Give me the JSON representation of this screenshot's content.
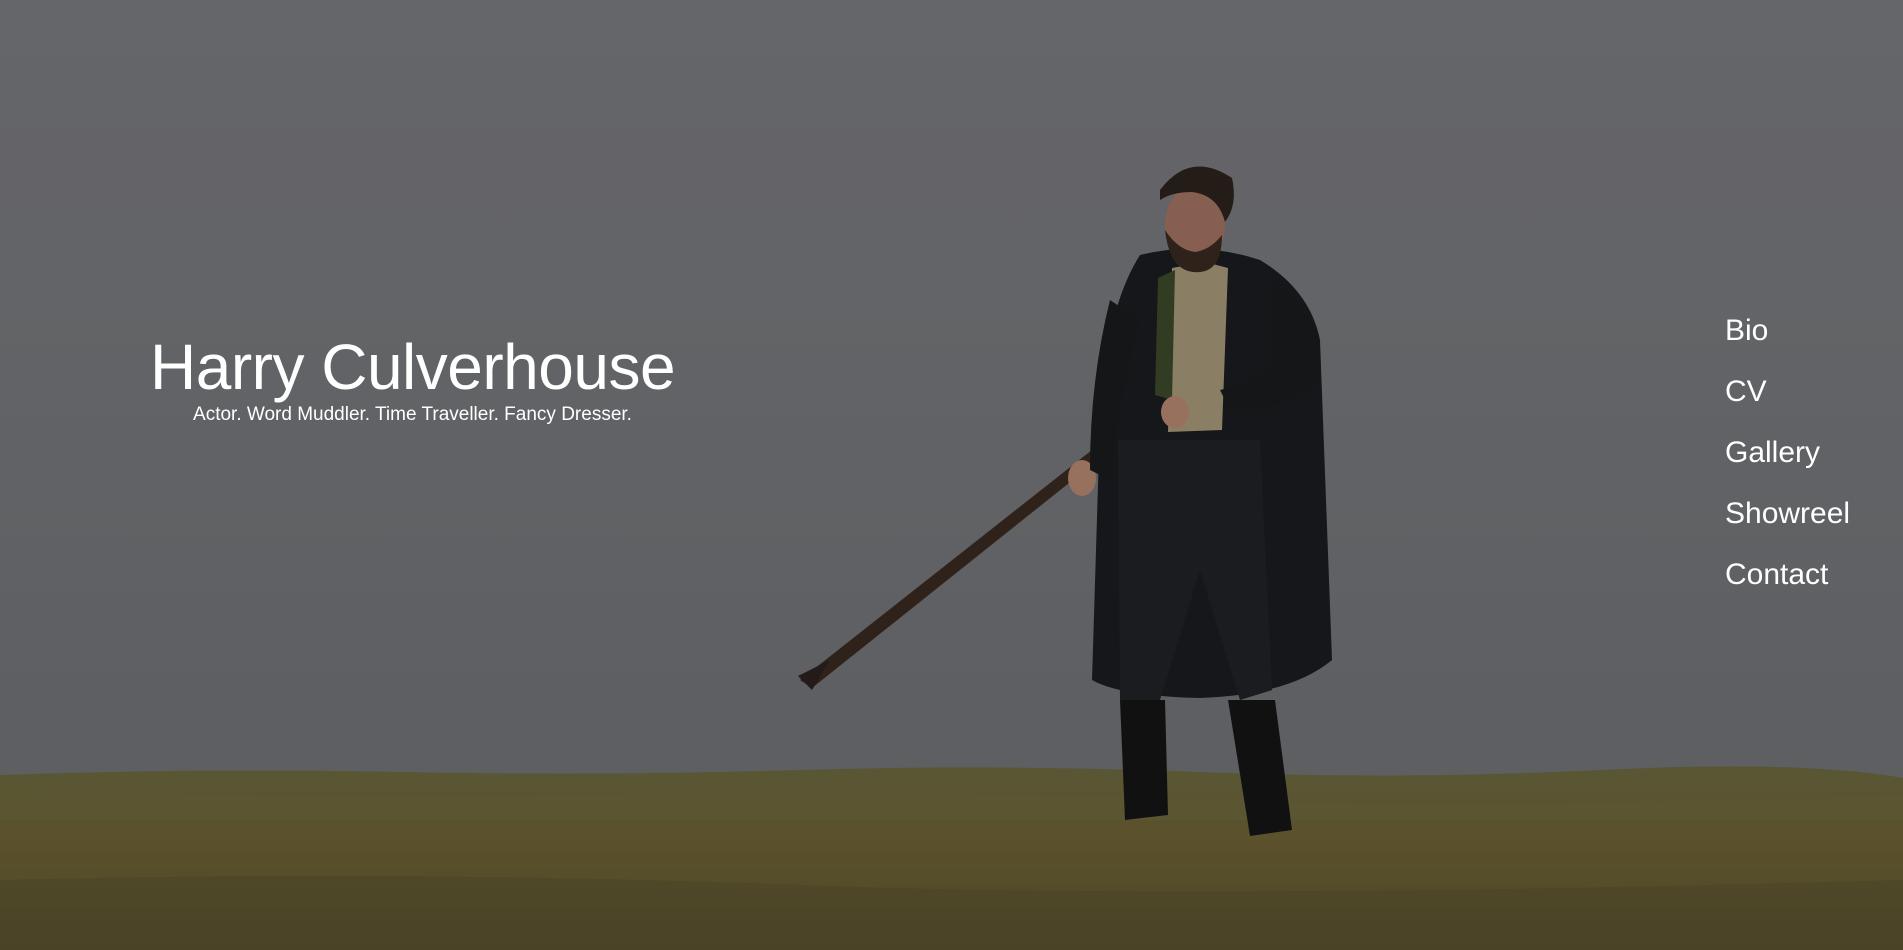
{
  "site": {
    "name": "Harry Culverhouse",
    "tagline": "Actor. Word Muddler. Time Traveller. Fancy Dresser."
  },
  "nav": {
    "items": [
      {
        "label": "Bio"
      },
      {
        "label": "CV"
      },
      {
        "label": "Gallery"
      },
      {
        "label": "Showreel"
      },
      {
        "label": "Contact"
      }
    ]
  },
  "colors": {
    "sky": "#74767a",
    "grass": "#6f6436",
    "text": "#ffffff"
  }
}
